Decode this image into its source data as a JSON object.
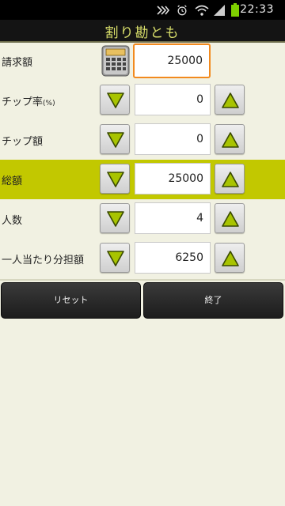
{
  "status_bar": {
    "time": "22:33",
    "icons": [
      "notification-icon",
      "alarm-icon",
      "wifi-icon",
      "signal-icon",
      "battery-icon"
    ]
  },
  "title": "割り勘とも",
  "rows": [
    {
      "label": "請求額",
      "value": "25000",
      "highlighted": false
    },
    {
      "label": "チップ率",
      "label_suffix": "(%)",
      "value": "0",
      "highlighted": false
    },
    {
      "label": "チップ額",
      "value": "0",
      "highlighted": false
    },
    {
      "label": "総額",
      "value": "25000",
      "highlighted": true
    },
    {
      "label": "人数",
      "value": "4",
      "highlighted": false
    },
    {
      "label": "一人当たり分担額",
      "value": "6250",
      "highlighted": false
    }
  ],
  "buttons": {
    "reset": "リセット",
    "exit": "終了"
  },
  "colors": {
    "highlight": "#c2c800",
    "arrow": "#a8c400",
    "title_text": "#d8de6a",
    "focus_border": "#f28a1e"
  }
}
